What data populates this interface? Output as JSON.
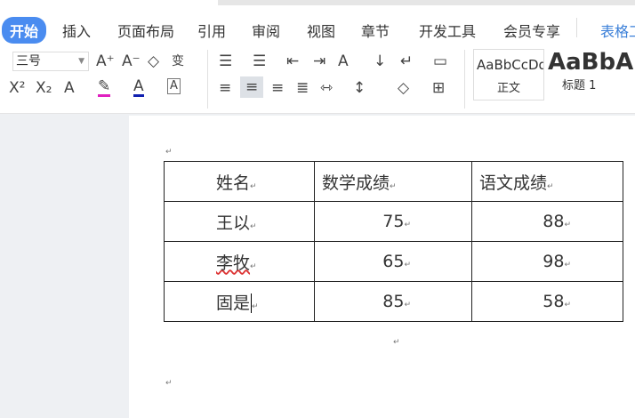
{
  "tabs": [
    "开始",
    "插入",
    "页面布局",
    "引用",
    "审阅",
    "视图",
    "章节",
    "开发工具",
    "会员专享",
    "表格工"
  ],
  "active_tab": "开始",
  "font_size": "三号",
  "styles": [
    {
      "preview": "AaBbCcDd",
      "label": "正文"
    },
    {
      "preview": "AaBbA",
      "label": "标题 1"
    }
  ],
  "table": {
    "headers": [
      "姓名",
      "数学成绩",
      "语文成绩"
    ],
    "rows": [
      [
        "王以",
        "75",
        "88"
      ],
      [
        "李牧",
        "65",
        "98"
      ],
      [
        "固是",
        "85",
        "58"
      ]
    ]
  },
  "colors": {
    "accent": "#4a8cf0",
    "highlight": "#e020c0",
    "font_color": "#1020b0"
  }
}
